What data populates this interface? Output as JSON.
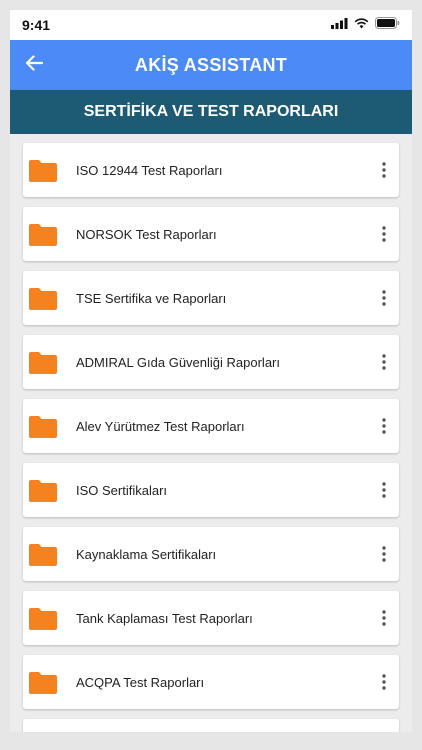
{
  "status_bar": {
    "time": "9:41"
  },
  "app_bar": {
    "title": "AKİŞ ASSISTANT"
  },
  "section": {
    "title": "SERTİFİKA VE TEST RAPORLARI"
  },
  "items": [
    {
      "label": "ISO 12944 Test Raporları"
    },
    {
      "label": "NORSOK Test Raporları"
    },
    {
      "label": "TSE Sertifika ve Raporları"
    },
    {
      "label": "ADMIRAL Gıda Güvenliği Raporları"
    },
    {
      "label": "Alev Yürütmez Test Raporları"
    },
    {
      "label": "ISO Sertifikaları"
    },
    {
      "label": "Kaynaklama Sertifikaları"
    },
    {
      "label": "Tank Kaplaması Test Raporları"
    },
    {
      "label": "ACQPA Test Raporları"
    },
    {
      "label": ""
    }
  ],
  "colors": {
    "app_bar": "#4a8bf7",
    "section_header": "#1d5a73",
    "folder": "#f5821f"
  },
  "icons": {
    "back": "arrow-left-icon",
    "folder": "folder-icon",
    "more": "more-vertical-icon",
    "signal": "cellular-signal-icon",
    "wifi": "wifi-icon",
    "battery": "battery-icon"
  }
}
